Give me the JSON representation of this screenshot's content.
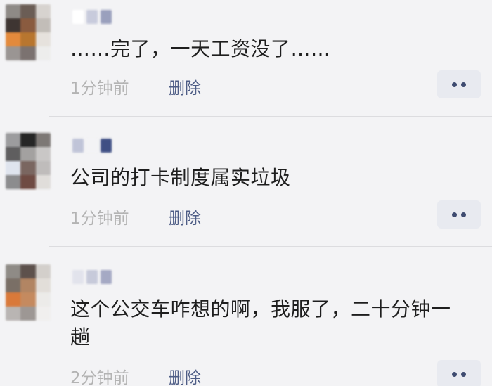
{
  "comments": [
    {
      "text": "……完了，一天工资没了……",
      "time": "1分钟前",
      "delete_label": "删除",
      "avatar_colors": [
        "#8e8a86",
        "#6b5d55",
        "#d7d3cf",
        "#3e3532",
        "#8a5b3f",
        "#c2bdb8",
        "#e38a3c",
        "#b8762f",
        "#e6e2dd",
        "#9a9593",
        "#7b7270",
        "#ededec"
      ],
      "name_colors": [
        "#ffffff",
        "#c8cbdc",
        "#9aa0bd"
      ]
    },
    {
      "text": "公司的打卡制度属实垃圾",
      "time": "1分钟前",
      "delete_label": "删除",
      "avatar_colors": [
        "#9c9c9e",
        "#262626",
        "#7d7875",
        "#5f5e5f",
        "#a3a1a0",
        "#c9c7c6",
        "#dfe4ee",
        "#7a6660",
        "#bfbcbb",
        "#8c8c8e",
        "#6f4b43",
        "#e0ddda"
      ],
      "name_colors": [
        "#c0c4d8",
        "#f3f3f5",
        "#3f4f84"
      ]
    },
    {
      "text": "这个公交车咋想的啊，我服了，二十分钟一趟",
      "time": "2分钟前",
      "delete_label": "删除",
      "avatar_colors": [
        "#8f8b86",
        "#5d514c",
        "#d3cfcb",
        "#7a6f66",
        "#b28563",
        "#e2ded9",
        "#d9793a",
        "#c58a5f",
        "#ecebe9",
        "#b9b5b3",
        "#9d9794",
        "#f0efee"
      ],
      "name_colors": [
        "#e2e3ec",
        "#c7cada",
        "#a5a9c4"
      ]
    }
  ],
  "icons": {
    "more": "more-dots-icon"
  },
  "colors": {
    "background": "#f3f3f5",
    "delete_link": "#4e5d86",
    "time_text": "#b3b3b3",
    "more_button_bg": "#e8eaf0"
  }
}
